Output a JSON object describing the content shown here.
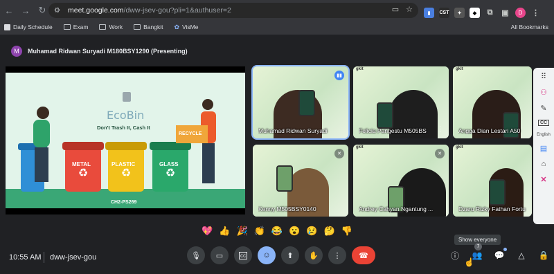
{
  "browser": {
    "url_host": "meet.google.com",
    "url_path": "/dww-jsev-gou?pli=1&authuser=2",
    "extensions": [
      "CST"
    ],
    "profile_initial": "D",
    "bookmarks": [
      "Daily Schedule",
      "Exam",
      "Work",
      "Bangkit",
      "VisMe"
    ],
    "all_bookmarks": "All Bookmarks"
  },
  "presenting": {
    "initial": "M",
    "text": "Muhamad Ridwan Suryadi M180BSY1290 (Presenting)"
  },
  "slide": {
    "brand": "EcoBin",
    "tagline": "Don't Trash It, Cash It",
    "bins": [
      "METAL",
      "PLASTIC",
      "GLASS"
    ],
    "box_label": "RECYCLE",
    "team": "CH2-PS269"
  },
  "tiles": [
    {
      "name": "Muhamad Ridwan Suryadi",
      "mic": "active"
    },
    {
      "name": "Felicia Pangestu M505BS",
      "mic": "none"
    },
    {
      "name": "Angga Dian Lestari A50",
      "mic": "none"
    },
    {
      "name": "Kenny M505BSY0140",
      "mic": "muted"
    },
    {
      "name": "Andrey Cahyan Ngantung ...",
      "mic": "muted"
    },
    {
      "name": "Dzaru Rizky Fathan Fortu",
      "mic": "none"
    }
  ],
  "tile_brand": "gkit",
  "side_rail": [
    "apps-icon",
    "activities-icon",
    "pen-icon",
    "CC",
    "English",
    "docs-icon",
    "camera-icon",
    "x-icon"
  ],
  "side_rail_labels": {
    "cc": "CC",
    "lang": "English"
  },
  "reactions": [
    "💖",
    "👍",
    "🎉",
    "👏",
    "😂",
    "😮",
    "😢",
    "🤔",
    "👎"
  ],
  "meeting": {
    "time": "10:55 AM",
    "code": "dww-jsev-gou"
  },
  "participants_count": "7",
  "tooltip": "Show everyone",
  "colors": {
    "end_call": "#ea4335",
    "active": "#8ab4f8",
    "bg": "#202124"
  }
}
